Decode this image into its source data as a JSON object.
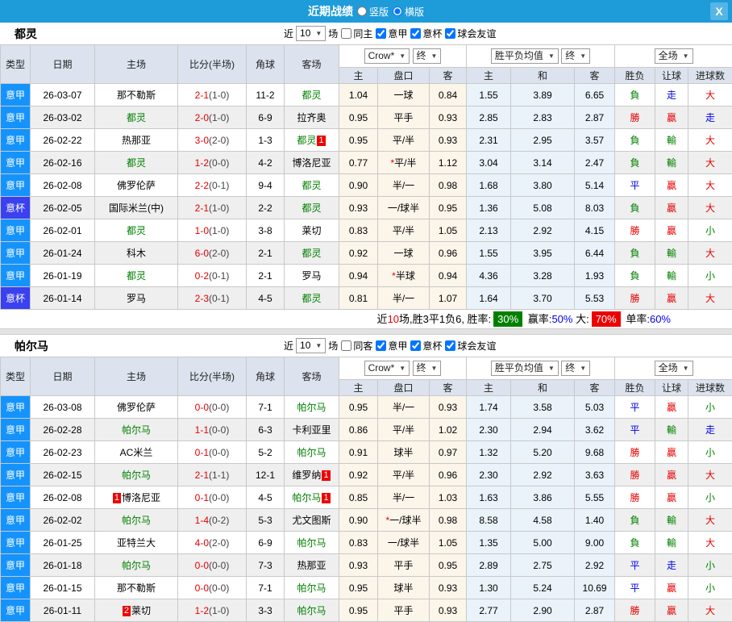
{
  "titlebar": {
    "title": "近期战绩",
    "radios": [
      {
        "label": "竖版"
      },
      {
        "label": "横版",
        "checked": "checked"
      }
    ],
    "close_label": "X"
  },
  "table_header": {
    "left": [
      "类型",
      "日期",
      "主场",
      "比分(半场)",
      "角球",
      "客场"
    ],
    "sub": [
      "主",
      "盘口",
      "客",
      "主",
      "和",
      "客",
      "胜负",
      "让球",
      "进球数"
    ],
    "selects": {
      "company": "Crow*",
      "final1": "终",
      "avg_name": "胜平负均值",
      "final2": "终",
      "scope": "全场"
    }
  },
  "colors": {
    "titlebar_blue": "#1e9bd9",
    "serie_a_badge": "#1593fc",
    "cup_badge": "#3a41f0",
    "win_red": "#e60000",
    "lose_green": "#008000",
    "draw_blue": "#0000ee"
  },
  "sections": [
    {
      "team": "都灵",
      "filter": {
        "near": "近",
        "count": "10",
        "games": "场",
        "same": {
          "label": "同主"
        },
        "leagues": [
          {
            "label": "意甲",
            "checked": "checked"
          },
          {
            "label": "意杯",
            "checked": "checked"
          },
          {
            "label": "球会友谊",
            "checked": "checked"
          }
        ]
      },
      "rows": [
        {
          "league": "意甲",
          "date": "26-03-07",
          "home": {
            "text": "那不勒斯"
          },
          "score": "2-1",
          "half": "(1-0)",
          "corner": "11-2",
          "away": {
            "text": "都灵",
            "green": true
          },
          "odds": [
            "1.04",
            "一球",
            "0.84"
          ],
          "avg": [
            "1.55",
            "3.89",
            "6.65"
          ],
          "results": [
            [
              "負",
              "g"
            ],
            [
              "走",
              "b"
            ],
            [
              "大",
              "r"
            ]
          ]
        },
        {
          "league": "意甲",
          "date": "26-03-02",
          "home": {
            "text": "都灵",
            "green": true
          },
          "score": "2-0",
          "half": "(1-0)",
          "corner": "6-9",
          "away": {
            "text": "拉齐奥"
          },
          "odds": [
            "0.95",
            "平手",
            "0.93"
          ],
          "avg": [
            "2.85",
            "2.83",
            "2.87"
          ],
          "results": [
            [
              "勝",
              "r"
            ],
            [
              "贏",
              "r"
            ],
            [
              "走",
              "b"
            ]
          ]
        },
        {
          "league": "意甲",
          "date": "26-02-22",
          "home": {
            "text": "热那亚"
          },
          "score": "3-0",
          "half": "(2-0)",
          "corner": "1-3",
          "away": {
            "text": "都灵",
            "green": true,
            "post": "1"
          },
          "odds": [
            "0.95",
            "平/半",
            "0.93"
          ],
          "avg": [
            "2.31",
            "2.95",
            "3.57"
          ],
          "results": [
            [
              "負",
              "g"
            ],
            [
              "輸",
              "g"
            ],
            [
              "大",
              "r"
            ]
          ]
        },
        {
          "league": "意甲",
          "date": "26-02-16",
          "home": {
            "text": "都灵",
            "green": true
          },
          "score": "1-2",
          "half": "(0-0)",
          "corner": "4-2",
          "away": {
            "text": "博洛尼亚"
          },
          "odds": [
            "0.77",
            "*平/半",
            "1.12"
          ],
          "avg": [
            "3.04",
            "3.14",
            "2.47"
          ],
          "results": [
            [
              "負",
              "g"
            ],
            [
              "輸",
              "g"
            ],
            [
              "大",
              "r"
            ]
          ]
        },
        {
          "league": "意甲",
          "date": "26-02-08",
          "home": {
            "text": "佛罗伦萨"
          },
          "score": "2-2",
          "half": "(0-1)",
          "corner": "9-4",
          "away": {
            "text": "都灵",
            "green": true
          },
          "odds": [
            "0.90",
            "半/一",
            "0.98"
          ],
          "avg": [
            "1.68",
            "3.80",
            "5.14"
          ],
          "results": [
            [
              "平",
              "b"
            ],
            [
              "贏",
              "r"
            ],
            [
              "大",
              "r"
            ]
          ]
        },
        {
          "league": "意杯",
          "cup": true,
          "date": "26-02-05",
          "home": {
            "text": "国际米兰(中)"
          },
          "score": "2-1",
          "half": "(1-0)",
          "corner": "2-2",
          "away": {
            "text": "都灵",
            "green": true
          },
          "odds": [
            "0.93",
            "一/球半",
            "0.95"
          ],
          "avg": [
            "1.36",
            "5.08",
            "8.03"
          ],
          "results": [
            [
              "負",
              "g"
            ],
            [
              "贏",
              "r"
            ],
            [
              "大",
              "r"
            ]
          ]
        },
        {
          "league": "意甲",
          "date": "26-02-01",
          "home": {
            "text": "都灵",
            "green": true
          },
          "score": "1-0",
          "half": "(1-0)",
          "corner": "3-8",
          "away": {
            "text": "莱切"
          },
          "odds": [
            "0.83",
            "平/半",
            "1.05"
          ],
          "avg": [
            "2.13",
            "2.92",
            "4.15"
          ],
          "results": [
            [
              "勝",
              "r"
            ],
            [
              "贏",
              "r"
            ],
            [
              "小",
              "g"
            ]
          ]
        },
        {
          "league": "意甲",
          "date": "26-01-24",
          "home": {
            "text": "科木"
          },
          "score": "6-0",
          "half": "(2-0)",
          "corner": "2-1",
          "away": {
            "text": "都灵",
            "green": true
          },
          "odds": [
            "0.92",
            "一球",
            "0.96"
          ],
          "avg": [
            "1.55",
            "3.95",
            "6.44"
          ],
          "results": [
            [
              "負",
              "g"
            ],
            [
              "輸",
              "g"
            ],
            [
              "大",
              "r"
            ]
          ]
        },
        {
          "league": "意甲",
          "date": "26-01-19",
          "home": {
            "text": "都灵",
            "green": true
          },
          "score": "0-2",
          "half": "(0-1)",
          "corner": "2-1",
          "away": {
            "text": "罗马"
          },
          "odds": [
            "0.94",
            "*半球",
            "0.94"
          ],
          "avg": [
            "4.36",
            "3.28",
            "1.93"
          ],
          "results": [
            [
              "負",
              "g"
            ],
            [
              "輸",
              "g"
            ],
            [
              "小",
              "g"
            ]
          ]
        },
        {
          "league": "意杯",
          "cup": true,
          "date": "26-01-14",
          "home": {
            "text": "罗马"
          },
          "score": "2-3",
          "half": "(0-1)",
          "corner": "4-5",
          "away": {
            "text": "都灵",
            "green": true
          },
          "odds": [
            "0.81",
            "半/一",
            "1.07"
          ],
          "avg": [
            "1.64",
            "3.70",
            "5.53"
          ],
          "results": [
            [
              "勝",
              "r"
            ],
            [
              "贏",
              "r"
            ],
            [
              "大",
              "r"
            ]
          ]
        }
      ],
      "summary": [
        {
          "t": "近"
        },
        {
          "t": "10",
          "cls": "red"
        },
        {
          "t": "场,胜3平1负6, 胜率:"
        },
        {
          "t": "30%",
          "cls": "badge-green"
        },
        {
          "t": " 赢率:"
        },
        {
          "t": "50%",
          "cls": "blue"
        },
        {
          "t": " 大:"
        },
        {
          "t": "70%",
          "cls": "badge-red"
        },
        {
          "t": " 单率:"
        },
        {
          "t": "60%",
          "cls": "blue"
        }
      ]
    },
    {
      "team": "帕尔马",
      "filter": {
        "near": "近",
        "count": "10",
        "games": "场",
        "same": {
          "label": "同客"
        },
        "leagues": [
          {
            "label": "意甲",
            "checked": "checked"
          },
          {
            "label": "意杯",
            "checked": "checked"
          },
          {
            "label": "球会友谊",
            "checked": "checked"
          }
        ]
      },
      "rows": [
        {
          "league": "意甲",
          "date": "26-03-08",
          "home": {
            "text": "佛罗伦萨"
          },
          "score": "0-0",
          "half": "(0-0)",
          "corner": "7-1",
          "away": {
            "text": "帕尔马",
            "green": true
          },
          "odds": [
            "0.95",
            "半/一",
            "0.93"
          ],
          "avg": [
            "1.74",
            "3.58",
            "5.03"
          ],
          "results": [
            [
              "平",
              "b"
            ],
            [
              "贏",
              "r"
            ],
            [
              "小",
              "g"
            ]
          ]
        },
        {
          "league": "意甲",
          "date": "26-02-28",
          "home": {
            "text": "帕尔马",
            "green": true
          },
          "score": "1-1",
          "half": "(0-0)",
          "corner": "6-3",
          "away": {
            "text": "卡利亚里"
          },
          "odds": [
            "0.86",
            "平/半",
            "1.02"
          ],
          "avg": [
            "2.30",
            "2.94",
            "3.62"
          ],
          "results": [
            [
              "平",
              "b"
            ],
            [
              "輸",
              "g"
            ],
            [
              "走",
              "b"
            ]
          ]
        },
        {
          "league": "意甲",
          "date": "26-02-23",
          "home": {
            "text": "AC米兰"
          },
          "score": "0-1",
          "half": "(0-0)",
          "corner": "5-2",
          "away": {
            "text": "帕尔马",
            "green": true
          },
          "odds": [
            "0.91",
            "球半",
            "0.97"
          ],
          "avg": [
            "1.32",
            "5.20",
            "9.68"
          ],
          "results": [
            [
              "勝",
              "r"
            ],
            [
              "贏",
              "r"
            ],
            [
              "小",
              "g"
            ]
          ]
        },
        {
          "league": "意甲",
          "date": "26-02-15",
          "home": {
            "text": "帕尔马",
            "green": true
          },
          "score": "2-1",
          "half": "(1-1)",
          "corner": "12-1",
          "away": {
            "text": "维罗纳",
            "post": "1"
          },
          "odds": [
            "0.92",
            "平/半",
            "0.96"
          ],
          "avg": [
            "2.30",
            "2.92",
            "3.63"
          ],
          "results": [
            [
              "勝",
              "r"
            ],
            [
              "贏",
              "r"
            ],
            [
              "大",
              "r"
            ]
          ]
        },
        {
          "league": "意甲",
          "date": "26-02-08",
          "home": {
            "pre": "1",
            "text": "博洛尼亚"
          },
          "score": "0-1",
          "half": "(0-0)",
          "corner": "4-5",
          "away": {
            "text": "帕尔马",
            "green": true,
            "post": "1"
          },
          "odds": [
            "0.85",
            "半/一",
            "1.03"
          ],
          "avg": [
            "1.63",
            "3.86",
            "5.55"
          ],
          "results": [
            [
              "勝",
              "r"
            ],
            [
              "贏",
              "r"
            ],
            [
              "小",
              "g"
            ]
          ]
        },
        {
          "league": "意甲",
          "date": "26-02-02",
          "home": {
            "text": "帕尔马",
            "green": true
          },
          "score": "1-4",
          "half": "(0-2)",
          "corner": "5-3",
          "away": {
            "text": "尤文图斯"
          },
          "odds": [
            "0.90",
            "*一/球半",
            "0.98"
          ],
          "avg": [
            "8.58",
            "4.58",
            "1.40"
          ],
          "results": [
            [
              "負",
              "g"
            ],
            [
              "輸",
              "g"
            ],
            [
              "大",
              "r"
            ]
          ]
        },
        {
          "league": "意甲",
          "date": "26-01-25",
          "home": {
            "text": "亚特兰大"
          },
          "score": "4-0",
          "half": "(2-0)",
          "corner": "6-9",
          "away": {
            "text": "帕尔马",
            "green": true
          },
          "odds": [
            "0.83",
            "一/球半",
            "1.05"
          ],
          "avg": [
            "1.35",
            "5.00",
            "9.00"
          ],
          "results": [
            [
              "負",
              "g"
            ],
            [
              "輸",
              "g"
            ],
            [
              "大",
              "r"
            ]
          ]
        },
        {
          "league": "意甲",
          "date": "26-01-18",
          "home": {
            "text": "帕尔马",
            "green": true
          },
          "score": "0-0",
          "half": "(0-0)",
          "corner": "7-3",
          "away": {
            "text": "热那亚"
          },
          "odds": [
            "0.93",
            "平手",
            "0.95"
          ],
          "avg": [
            "2.89",
            "2.75",
            "2.92"
          ],
          "results": [
            [
              "平",
              "b"
            ],
            [
              "走",
              "b"
            ],
            [
              "小",
              "g"
            ]
          ]
        },
        {
          "league": "意甲",
          "date": "26-01-15",
          "home": {
            "text": "那不勒斯"
          },
          "score": "0-0",
          "half": "(0-0)",
          "corner": "7-1",
          "away": {
            "text": "帕尔马",
            "green": true
          },
          "odds": [
            "0.95",
            "球半",
            "0.93"
          ],
          "avg": [
            "1.30",
            "5.24",
            "10.69"
          ],
          "results": [
            [
              "平",
              "b"
            ],
            [
              "贏",
              "r"
            ],
            [
              "小",
              "g"
            ]
          ]
        },
        {
          "league": "意甲",
          "date": "26-01-11",
          "home": {
            "pre": "2",
            "text": "莱切"
          },
          "score": "1-2",
          "half": "(1-0)",
          "corner": "3-3",
          "away": {
            "text": "帕尔马",
            "green": true
          },
          "odds": [
            "0.95",
            "平手",
            "0.93"
          ],
          "avg": [
            "2.77",
            "2.90",
            "2.87"
          ],
          "results": [
            [
              "勝",
              "r"
            ],
            [
              "贏",
              "r"
            ],
            [
              "大",
              "r"
            ]
          ]
        }
      ]
    }
  ]
}
